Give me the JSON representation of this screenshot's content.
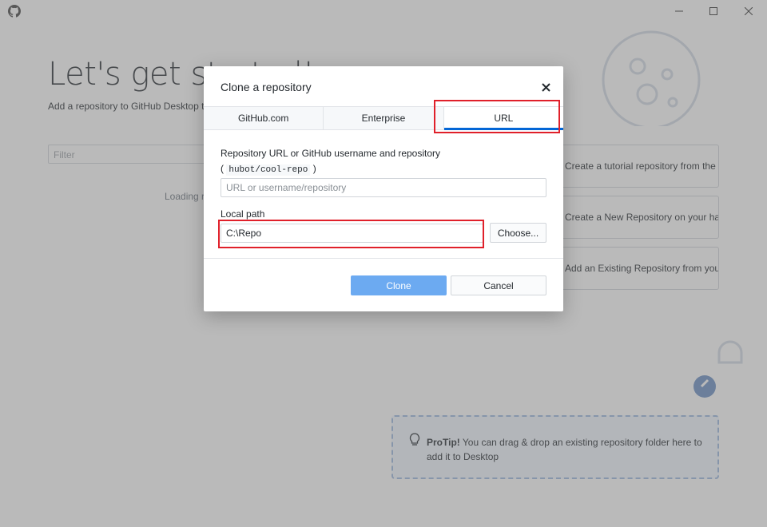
{
  "welcome": {
    "title": "Let's get started!",
    "subtitle": "Add a repository to GitHub Desktop to start collaborating",
    "filter_placeholder": "Filter",
    "loading_text": "Loading repositories…"
  },
  "options": [
    {
      "label": "Create a tutorial repository from the Internet..."
    },
    {
      "label": "Create a New Repository on your hard drive..."
    },
    {
      "label": "Add an Existing Repository from your hard drive..."
    }
  ],
  "protip": {
    "bold": "ProTip!",
    "text": " You can drag & drop an existing repository folder here to add it to Desktop"
  },
  "dialog": {
    "title": "Clone a repository",
    "tabs": [
      {
        "label": "GitHub.com"
      },
      {
        "label": "Enterprise"
      },
      {
        "label": "URL"
      }
    ],
    "url_label": "Repository URL or GitHub username and repository",
    "url_example": "hubot/cool-repo",
    "url_placeholder": "URL or username/repository",
    "url_value": "",
    "path_label": "Local path",
    "path_value": "C:\\Repo",
    "choose_label": "Choose...",
    "clone_label": "Clone",
    "cancel_label": "Cancel"
  },
  "colors": {
    "accent": "#0366d6",
    "primary_button": "#6caaf1",
    "highlight": "#e0202a"
  }
}
